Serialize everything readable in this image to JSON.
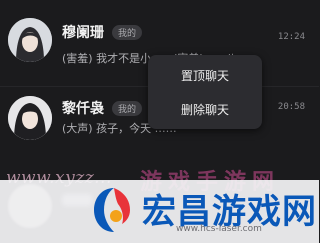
{
  "chats": [
    {
      "name": "穆阑珊",
      "tag": "我的",
      "time": "12:24",
      "preview": "(害羞) 我才不是小……(害羞)……八…"
    },
    {
      "name": "黎仟袅",
      "tag": "我的",
      "time": "20:58",
      "preview": "(大声) 孩子，今天 ……"
    }
  ],
  "context_menu": {
    "pin_label": "置顶聊天",
    "delete_label": "删除聊天"
  },
  "watermark": {
    "url_text": "www.xyzz...",
    "cn_text": "游戏手游网"
  },
  "overlay": {
    "title": "宏昌游戏网",
    "url": "www.hcs-laser.com",
    "brand_color": "#0a58b8"
  }
}
